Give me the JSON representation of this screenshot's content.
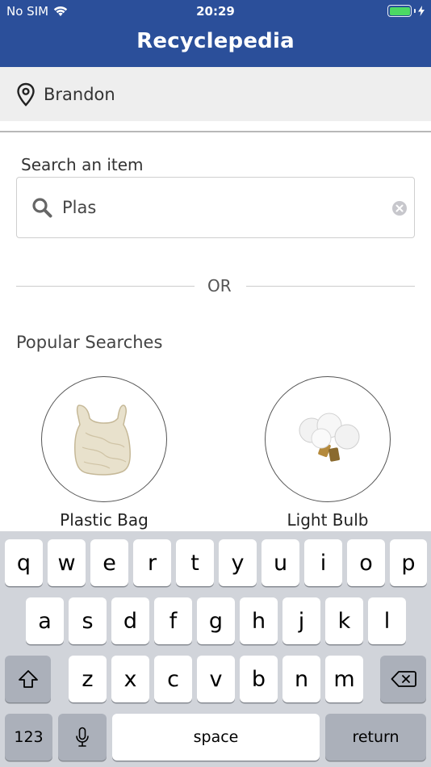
{
  "status_bar": {
    "carrier": "No SIM",
    "time": "20:29"
  },
  "nav": {
    "title": "Recyclepedia"
  },
  "location": {
    "label": "Brandon"
  },
  "search": {
    "label": "Search an item",
    "value": "Plas"
  },
  "separator": {
    "text": "OR"
  },
  "popular": {
    "title": "Popular Searches",
    "items": [
      {
        "label": "Plastic Bag"
      },
      {
        "label": "Light Bulb"
      }
    ]
  },
  "keyboard": {
    "row1": [
      "q",
      "w",
      "e",
      "r",
      "t",
      "y",
      "u",
      "i",
      "o",
      "p"
    ],
    "row2": [
      "a",
      "s",
      "d",
      "f",
      "g",
      "h",
      "j",
      "k",
      "l"
    ],
    "row3": [
      "z",
      "x",
      "c",
      "v",
      "b",
      "n",
      "m"
    ],
    "numbers_label": "123",
    "space_label": "space",
    "return_label": "return"
  },
  "colors": {
    "header": "#2b4f9a",
    "location_bg": "#eeeeee",
    "keyboard_bg": "#d1d4da"
  }
}
